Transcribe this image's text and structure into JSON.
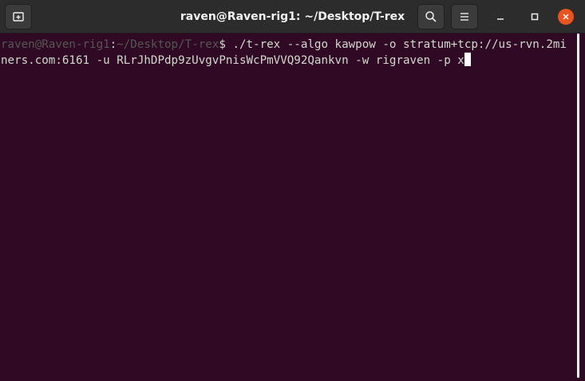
{
  "window": {
    "title": "raven@Raven-rig1: ~/Desktop/T-rex"
  },
  "icons": {
    "new_tab": "new-tab-icon",
    "search": "search-icon",
    "menu": "hamburger-menu-icon",
    "minimize": "minimize-icon",
    "maximize": "maximize-icon",
    "close": "close-icon"
  },
  "terminal": {
    "prompt_user": "raven@Raven-rig1",
    "prompt_sep": ":",
    "prompt_path": "~/Desktop/T-rex",
    "prompt_symbol": "$ ",
    "command": "./t-rex --algo kawpow -o stratum+tcp://us-rvn.2miners.com:6161 -u RLrJhDPdp9zUvgvPnisWcPmVVQ92Qankvn -w rigraven -p x"
  },
  "colors": {
    "background": "#300a24",
    "titlebar": "#2c2c2c",
    "close_button": "#e95420",
    "prompt": "#555555",
    "text": "#d3d7cf"
  }
}
